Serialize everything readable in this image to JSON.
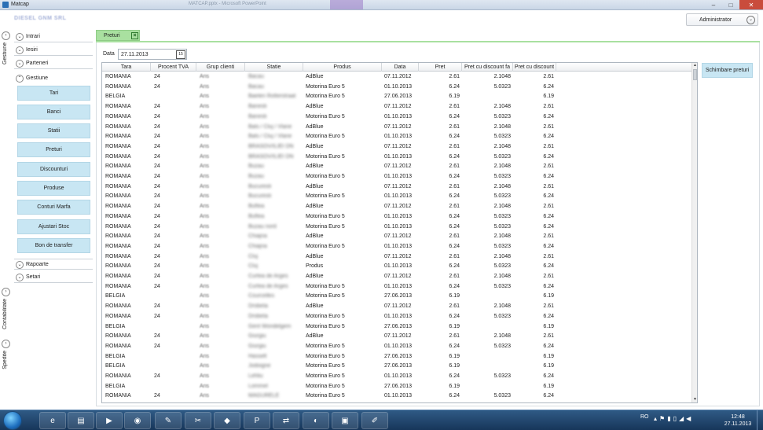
{
  "window": {
    "title": "Matcap",
    "background_title": "MATCAP.pptx - Microsoft PowerPoint",
    "badge": "Drawing Tools"
  },
  "brand": "DIESEL GNM SRL",
  "user": {
    "name": "Administrator"
  },
  "vtabs": [
    {
      "label": "Gestiune"
    },
    {
      "label": "Contabilitate"
    },
    {
      "label": "Spedite"
    }
  ],
  "nav": {
    "sections": [
      {
        "label": "Intrari",
        "state": "collapsed"
      },
      {
        "label": "Iesiri",
        "state": "collapsed"
      },
      {
        "label": "Parteneri",
        "state": "collapsed"
      },
      {
        "label": "Gestiune",
        "state": "expanded"
      },
      {
        "label": "Rapoarte",
        "state": "collapsed"
      },
      {
        "label": "Setari",
        "state": "collapsed"
      }
    ],
    "buttons": [
      "Tari",
      "Banci",
      "Statii",
      "Preturi",
      "Discounturi",
      "Produse",
      "Conturi Marfa",
      "Ajustari Stoc",
      "Bon de transfer"
    ]
  },
  "doc_tab": {
    "label": "Preturi"
  },
  "filter": {
    "date_label": "Data",
    "date_value": "27.11.2013"
  },
  "action_button": "Schimbare preturi",
  "grid": {
    "columns": [
      "Tara",
      "Procent TVA",
      "Grup clienti",
      "Statie",
      "Produs",
      "Data",
      "Pret",
      "Pret cu discount fa",
      "Pret cu discount"
    ],
    "rows": [
      [
        "ROMANIA",
        "24",
        "Aris",
        "Bacau",
        "AdBlue",
        "07.11.2012",
        "2.61",
        "2.1048",
        "2.61"
      ],
      [
        "ROMANIA",
        "24",
        "Aris",
        "Bacau",
        "Motorina Euro 5",
        "01.10.2013",
        "6.24",
        "5.0323",
        "6.24"
      ],
      [
        "BELGIA",
        "",
        "Aris",
        "Baelen Rotterstraat",
        "Motorina Euro 5",
        "27.06.2013",
        "6.19",
        "",
        "6.19"
      ],
      [
        "ROMANIA",
        "24",
        "Aris",
        "Banesti",
        "AdBlue",
        "07.11.2012",
        "2.61",
        "2.1048",
        "2.61"
      ],
      [
        "ROMANIA",
        "24",
        "Aris",
        "Banesti",
        "Motorina Euro 5",
        "01.10.2013",
        "6.24",
        "5.0323",
        "6.24"
      ],
      [
        "ROMANIA",
        "24",
        "Aris",
        "Bals / Cluj / Vlane",
        "AdBlue",
        "07.11.2012",
        "2.61",
        "2.1048",
        "2.61"
      ],
      [
        "ROMANIA",
        "24",
        "Aris",
        "Bals / Cluj / Vlane",
        "Motorina Euro 5",
        "01.10.2013",
        "6.24",
        "5.0323",
        "6.24"
      ],
      [
        "ROMANIA",
        "24",
        "Aris",
        "BRASOV/ILIEI DN",
        "AdBlue",
        "07.11.2012",
        "2.61",
        "2.1048",
        "2.61"
      ],
      [
        "ROMANIA",
        "24",
        "Aris",
        "BRASOV/ILIEI DN",
        "Motorina Euro 5",
        "01.10.2013",
        "6.24",
        "5.0323",
        "6.24"
      ],
      [
        "ROMANIA",
        "24",
        "Aris",
        "Buzau",
        "AdBlue",
        "07.11.2012",
        "2.61",
        "2.1048",
        "2.61"
      ],
      [
        "ROMANIA",
        "24",
        "Aris",
        "Buzau",
        "Motorina Euro 5",
        "01.10.2013",
        "6.24",
        "5.0323",
        "6.24"
      ],
      [
        "ROMANIA",
        "24",
        "Aris",
        "Bucuresti",
        "AdBlue",
        "07.11.2012",
        "2.61",
        "2.1048",
        "2.61"
      ],
      [
        "ROMANIA",
        "24",
        "Aris",
        "Bucuresti",
        "Motorina Euro 5",
        "01.10.2013",
        "6.24",
        "5.0323",
        "6.24"
      ],
      [
        "ROMANIA",
        "24",
        "Aris",
        "Buftea",
        "AdBlue",
        "07.11.2012",
        "2.61",
        "2.1048",
        "2.61"
      ],
      [
        "ROMANIA",
        "24",
        "Aris",
        "Buftea",
        "Motorina Euro 5",
        "01.10.2013",
        "6.24",
        "5.0323",
        "6.24"
      ],
      [
        "ROMANIA",
        "24",
        "Aris",
        "Buzau nord",
        "Motorina Euro 5",
        "01.10.2013",
        "6.24",
        "5.0323",
        "6.24"
      ],
      [
        "ROMANIA",
        "24",
        "Aris",
        "Chiajna",
        "AdBlue",
        "07.11.2012",
        "2.61",
        "2.1048",
        "2.61"
      ],
      [
        "ROMANIA",
        "24",
        "Aris",
        "Chiajna",
        "Motorina Euro 5",
        "01.10.2013",
        "6.24",
        "5.0323",
        "6.24"
      ],
      [
        "ROMANIA",
        "24",
        "Aris",
        "Cluj",
        "AdBlue",
        "07.11.2012",
        "2.61",
        "2.1048",
        "2.61"
      ],
      [
        "ROMANIA",
        "24",
        "Aris",
        "Cluj",
        "Produs",
        "01.10.2013",
        "6.24",
        "5.0323",
        "6.24"
      ],
      [
        "ROMANIA",
        "24",
        "Aris",
        "Curtea de Arges",
        "AdBlue",
        "07.11.2012",
        "2.61",
        "2.1048",
        "2.61"
      ],
      [
        "ROMANIA",
        "24",
        "Aris",
        "Curtea de Arges",
        "Motorina Euro 5",
        "01.10.2013",
        "6.24",
        "5.0323",
        "6.24"
      ],
      [
        "BELGIA",
        "",
        "Aris",
        "Courcelles",
        "Motorina Euro 5",
        "27.06.2013",
        "6.19",
        "",
        "6.19"
      ],
      [
        "ROMANIA",
        "24",
        "Aris",
        "Drobeta",
        "AdBlue",
        "07.11.2012",
        "2.61",
        "2.1048",
        "2.61"
      ],
      [
        "ROMANIA",
        "24",
        "Aris",
        "Drobeta",
        "Motorina Euro 5",
        "01.10.2013",
        "6.24",
        "5.0323",
        "6.24"
      ],
      [
        "BELGIA",
        "",
        "Aris",
        "Gent Wondelgem",
        "Motorina Euro 5",
        "27.06.2013",
        "6.19",
        "",
        "6.19"
      ],
      [
        "ROMANIA",
        "24",
        "Aris",
        "Giurgiu",
        "AdBlue",
        "07.11.2012",
        "2.61",
        "2.1048",
        "2.61"
      ],
      [
        "ROMANIA",
        "24",
        "Aris",
        "Giurgiu",
        "Motorina Euro 5",
        "01.10.2013",
        "6.24",
        "5.0323",
        "6.24"
      ],
      [
        "BELGIA",
        "",
        "Aris",
        "Hasselt",
        "Motorina Euro 5",
        "27.06.2013",
        "6.19",
        "",
        "6.19"
      ],
      [
        "BELGIA",
        "",
        "Aris",
        "Jodoigne",
        "Motorina Euro 5",
        "27.06.2013",
        "6.19",
        "",
        "6.19"
      ],
      [
        "ROMANIA",
        "24",
        "Aris",
        "Lehliu",
        "Motorina Euro 5",
        "01.10.2013",
        "6.24",
        "5.0323",
        "6.24"
      ],
      [
        "BELGIA",
        "",
        "Aris",
        "Lommel",
        "Motorina Euro 5",
        "27.06.2013",
        "6.19",
        "",
        "6.19"
      ],
      [
        "ROMANIA",
        "24",
        "Aris",
        "MAGURELE",
        "Motorina Euro 5",
        "01.10.2013",
        "6.24",
        "5.0323",
        "6.24"
      ]
    ]
  },
  "taskbar": {
    "lang": "RO",
    "time": "12:48",
    "date": "27.11.2013"
  }
}
